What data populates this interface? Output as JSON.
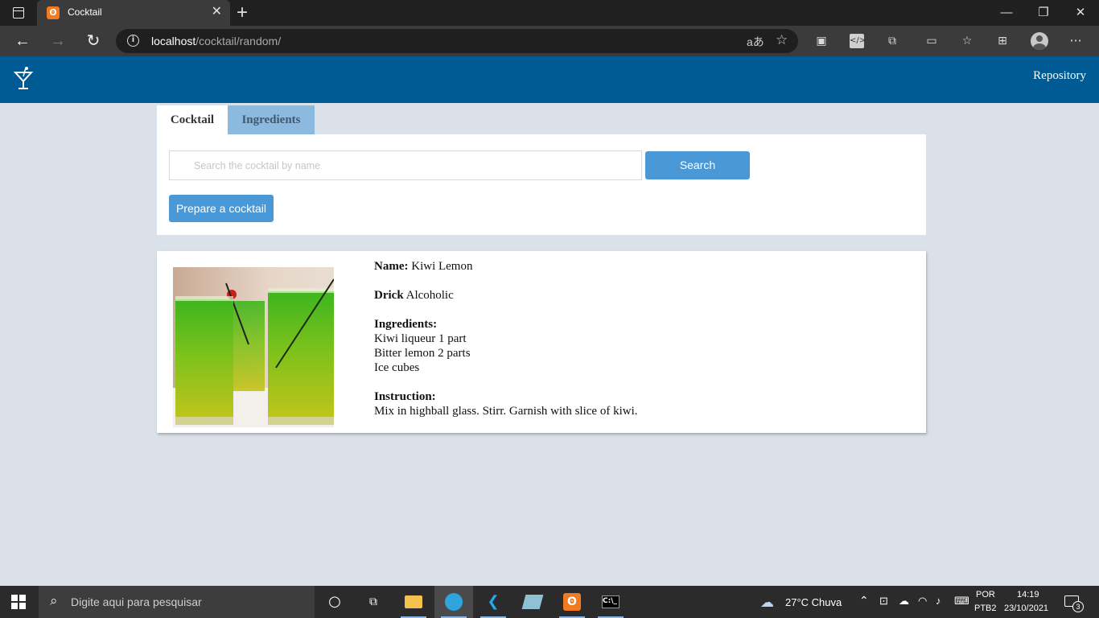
{
  "browser": {
    "tab_title": "Cocktail",
    "tab_favicon": "xampp-icon",
    "tab_close": "✕",
    "new_tab": "+",
    "window_controls": {
      "minimize": "—",
      "maximize": "❐",
      "close": "✕"
    },
    "url_host": "localhost",
    "url_path": "/cocktail/random/",
    "read_aloud_glyph": "aあ"
  },
  "header": {
    "logo_icon": "cocktail-glass-icon",
    "repository_link": "Repository",
    "background": "#005b94"
  },
  "tabs": [
    {
      "label": "Cocktail",
      "active": true
    },
    {
      "label": "Ingredients",
      "active": false
    }
  ],
  "search": {
    "placeholder": "Search the cocktail by name",
    "value": "",
    "button_label": "Search",
    "prepare_label": "Prepare a cocktail",
    "accent": "#4a98d6"
  },
  "result": {
    "name_label": "Name:",
    "name": "Kiwi Lemon",
    "drink_label": "Drick",
    "drink": "Alcoholic",
    "ingredients_label": "Ingredients:",
    "ingredients": [
      "Kiwi liqueur 1 part",
      "Bitter lemon 2 parts",
      "Ice cubes"
    ],
    "instruction_label": "Instruction:",
    "instruction": "Mix in highball glass. Stirr. Garnish with slice of kiwi."
  },
  "taskbar": {
    "search_placeholder": "Digite aqui para pesquisar",
    "weather": "27°C  Chuva",
    "lang_top": "POR",
    "lang_bottom": "PTB2",
    "time": "14:19",
    "date": "23/10/2021",
    "notifications": "3"
  }
}
